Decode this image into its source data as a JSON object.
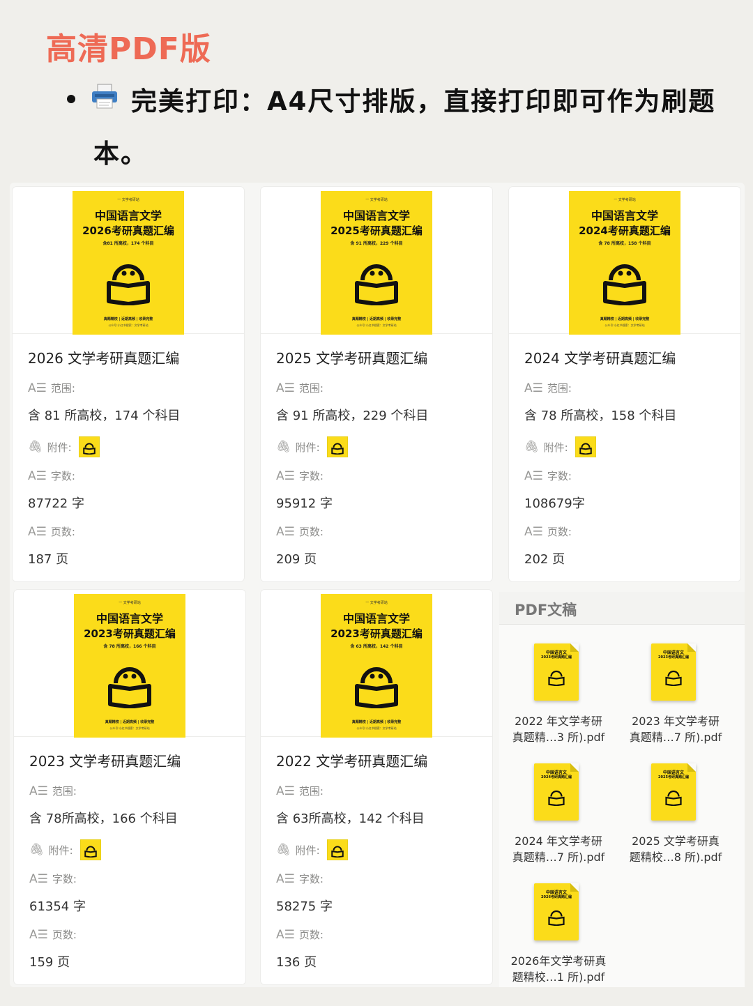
{
  "heading": "高清PDF版",
  "bullet": {
    "icon": "printer-icon",
    "text": "完美打印：A4尺寸排版，直接打印即可作为刷题本。"
  },
  "labels": {
    "range": "范围:",
    "attachment": "附件:",
    "words": "字数:",
    "pages": "页数:"
  },
  "cards": [
    {
      "cover": {
        "tag": "一 文学考研站",
        "line1": "中国语言文学",
        "line2": "2026考研真题汇编",
        "sub": "含81 所高校，174 个科目",
        "foot1": "真题精校 | 近期高频 | 收录完整",
        "foot2": "公众号:小红书搜索：文学考研站"
      },
      "title": "2026 文学考研真题汇编",
      "range": "含 81 所高校，174 个科目",
      "words": "87722 字",
      "pages": "187 页"
    },
    {
      "cover": {
        "tag": "一 文学考研站",
        "line1": "中国语言文学",
        "line2": "2025考研真题汇编",
        "sub": "含 91 所高校，229 个科目",
        "foot1": "真题精校 | 近期高频 | 收录完整",
        "foot2": "公众号:小红书搜索：文学考研站"
      },
      "title": "2025 文学考研真题汇编",
      "range": "含 91 所高校，229 个科目",
      "words": "95912 字",
      "pages": "209 页"
    },
    {
      "cover": {
        "tag": "一 文学考研站",
        "line1": "中国语言文学",
        "line2": "2024考研真题汇编",
        "sub": "含 78 所高校，158 个科目",
        "foot1": "真题精校 | 近期高频 | 收录完整",
        "foot2": "公众号:小红书搜索：文学考研站"
      },
      "title": "2024 文学考研真题汇编",
      "range": "含 78 所高校，158 个科目",
      "words": "108679字",
      "pages": "202 页"
    },
    {
      "cover": {
        "tag": "一 文学考研站",
        "line1": "中国语言文学",
        "line2": "2023考研真题汇编",
        "sub": "含 78 所高校，166 个科目",
        "foot1": "真题精校 | 近期高频 | 收录完整",
        "foot2": "公众号:小红书搜索：文学考研站"
      },
      "title": "2023 文学考研真题汇编",
      "range": "含 78所高校，166 个科目",
      "words": "61354 字",
      "pages": "159 页"
    },
    {
      "cover": {
        "tag": "一 文学考研站",
        "line1": "中国语言文学",
        "line2": "2023考研真题汇编",
        "sub": "含 63 所高校，142 个科目",
        "foot1": "真题精校 | 近期高频 | 收录完整",
        "foot2": "公众号:小红书搜索：文学考研站"
      },
      "title": "2022 文学考研真题汇编",
      "range": "含 63所高校，142 个科目",
      "words": "58275 字",
      "pages": "136 页"
    }
  ],
  "pdf_panel": {
    "title": "PDF文稿",
    "files": [
      {
        "doc_line1": "中国语言文",
        "doc_line2": "2023考研真题汇编",
        "name_line1": "2022 年文学考研",
        "name_line2": "真题精…3 所).pdf"
      },
      {
        "doc_line1": "中国语言文",
        "doc_line2": "2023考研真题汇编",
        "name_line1": "2023 年文学考研",
        "name_line2": "真题精…7 所).pdf"
      },
      {
        "doc_line1": "中国语言文",
        "doc_line2": "2024考研真题汇编",
        "name_line1": "2024 年文学考研",
        "name_line2": "真题精…7 所).pdf"
      },
      {
        "doc_line1": "中国语言文",
        "doc_line2": "2025考研真题汇编",
        "name_line1": "2025 文学考研真",
        "name_line2": "题精校…8 所).pdf"
      },
      {
        "doc_line1": "中国语言文",
        "doc_line2": "2026考研真题汇编",
        "name_line1": "2026年文学考研真",
        "name_line2": "题精校…1 所).pdf"
      }
    ]
  },
  "colors": {
    "heading": "#ee6a55",
    "cover": "#fbdc1a"
  }
}
